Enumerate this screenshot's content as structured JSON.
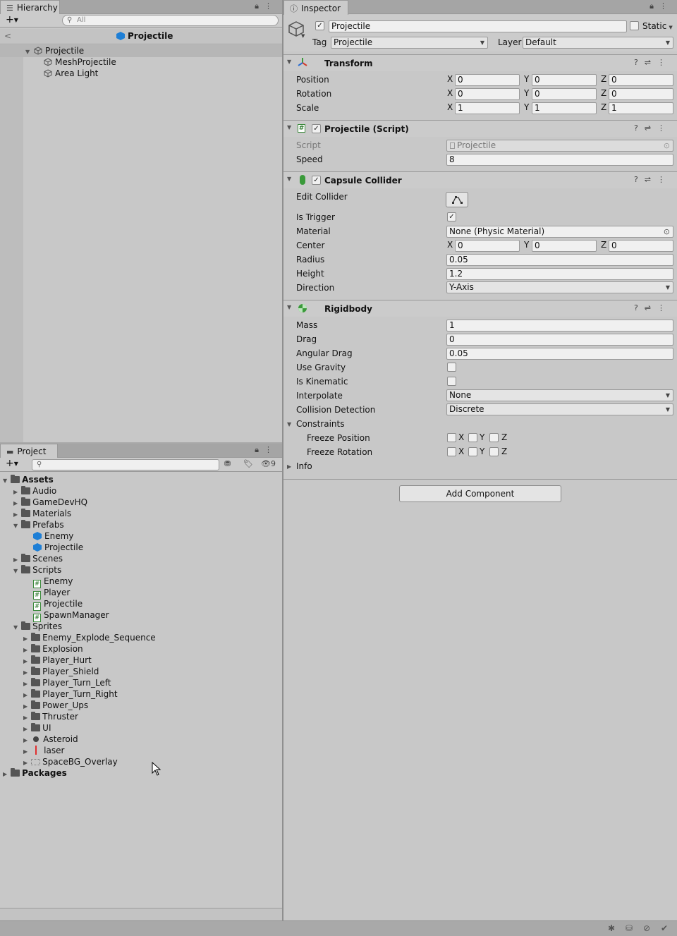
{
  "hierarchy": {
    "tab_label": "Hierarchy",
    "search_placeholder": "All",
    "scene_title": "Projectile",
    "items": [
      {
        "label": "Projectile"
      },
      {
        "label": "MeshProjectile"
      },
      {
        "label": "Area Light"
      }
    ]
  },
  "project": {
    "tab_label": "Project",
    "hidden_count": "9",
    "assets_label": "Assets",
    "packages_label": "Packages",
    "folders": {
      "audio": "Audio",
      "gamedevhq": "GameDevHQ",
      "materials": "Materials",
      "prefabs": "Prefabs",
      "scenes": "Scenes",
      "scripts": "Scripts",
      "sprites": "Sprites"
    },
    "prefabs": [
      "Enemy",
      "Projectile"
    ],
    "scripts": [
      "Enemy",
      "Player",
      "Projectile",
      "SpawnManager"
    ],
    "sprites": [
      "Enemy_Explode_Sequence",
      "Explosion",
      "Player_Hurt",
      "Player_Shield",
      "Player_Turn_Left",
      "Player_Turn_Right",
      "Power_Ups",
      "Thruster",
      "UI",
      "Asteroid",
      "laser",
      "SpaceBG_Overlay"
    ]
  },
  "inspector": {
    "tab_label": "Inspector",
    "object_name": "Projectile",
    "static_label": "Static",
    "tag_label": "Tag",
    "tag_value": "Projectile",
    "layer_label": "Layer",
    "layer_value": "Default",
    "transform": {
      "title": "Transform",
      "position_label": "Position",
      "rotation_label": "Rotation",
      "scale_label": "Scale",
      "position": [
        "0",
        "0",
        "0"
      ],
      "rotation": [
        "0",
        "0",
        "0"
      ],
      "scale": [
        "1",
        "1",
        "1"
      ]
    },
    "axes": [
      "X",
      "Y",
      "Z"
    ],
    "script": {
      "title": "Projectile (Script)",
      "script_label": "Script",
      "script_value": "Projectile",
      "speed_label": "Speed",
      "speed_value": "8"
    },
    "capsule": {
      "title": "Capsule Collider",
      "edit_label": "Edit Collider",
      "trigger_label": "Is Trigger",
      "material_label": "Material",
      "material_value": "None (Physic Material)",
      "center_label": "Center",
      "center": [
        "0",
        "0",
        "0"
      ],
      "radius_label": "Radius",
      "radius_value": "0.05",
      "height_label": "Height",
      "height_value": "1.2",
      "direction_label": "Direction",
      "direction_value": "Y-Axis"
    },
    "rigidbody": {
      "title": "Rigidbody",
      "mass_label": "Mass",
      "mass_value": "1",
      "drag_label": "Drag",
      "drag_value": "0",
      "angular_label": "Angular Drag",
      "angular_value": "0.05",
      "gravity_label": "Use Gravity",
      "kinematic_label": "Is Kinematic",
      "interpolate_label": "Interpolate",
      "interpolate_value": "None",
      "collision_label": "Collision Detection",
      "collision_value": "Discrete",
      "constraints_label": "Constraints",
      "freeze_pos_label": "Freeze Position",
      "freeze_rot_label": "Freeze Rotation",
      "info_label": "Info"
    },
    "add_component_label": "Add Component"
  }
}
